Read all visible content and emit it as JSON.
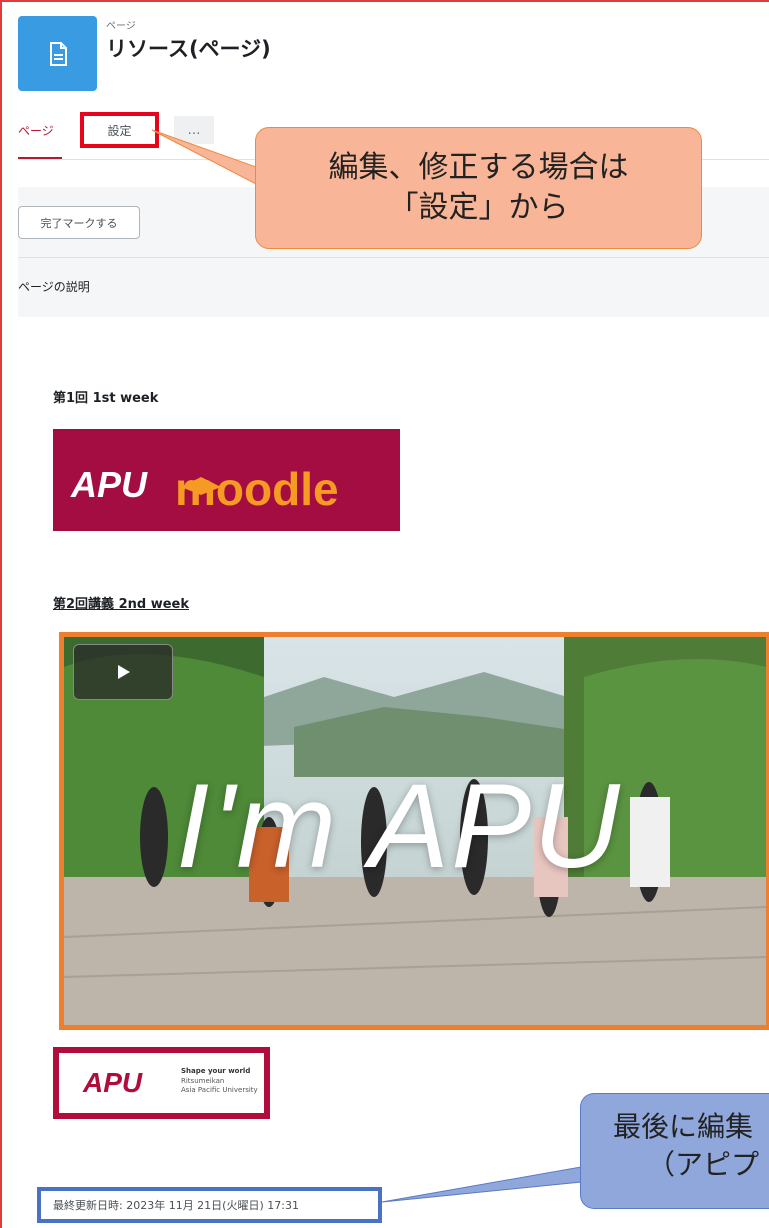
{
  "header": {
    "type_label": "ページ",
    "title": "リソース(ページ)",
    "icon": "page-icon"
  },
  "tabs": [
    {
      "label": "ページ",
      "active": true
    },
    {
      "label": "設定",
      "active": false
    },
    {
      "label": "…",
      "active": false
    }
  ],
  "activity": {
    "complete_button": "完了マークする",
    "description_label": "ページの説明"
  },
  "content": {
    "week1_heading": "第1回 1st week",
    "moodle_logo_text": "APU moodle",
    "week2_heading": "第2回講義 2nd week",
    "video_title": "I'm APU",
    "apu_logo": {
      "mark": "APU",
      "tagline": "Shape your world",
      "name_line1": "Ritsumeikan",
      "name_line2": "Asia Pacific University"
    },
    "last_modified": "最終更新日時: 2023年 11月 21日(火曜日) 17:31"
  },
  "callouts": {
    "settings_line1": "編集、修正する場合は",
    "settings_line2": "「設定」から",
    "modified_line1": "最後に編集",
    "modified_line2": "（アピプ"
  },
  "colors": {
    "accent": "#b31b33",
    "page_icon_bg": "#399be2",
    "settings_highlight": "#e8051b",
    "video_border": "#ee7f2f",
    "last_mod_border": "#4a72c4",
    "callout_orange": "#f8b598",
    "callout_blue": "#90a7dc"
  }
}
